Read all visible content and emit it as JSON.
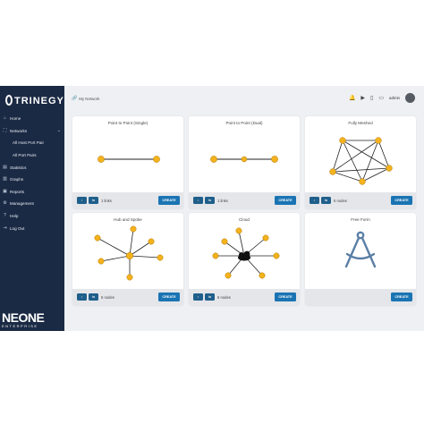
{
  "brand": {
    "name": "TRINEGY"
  },
  "sidebar": {
    "items": [
      {
        "label": "Home",
        "icon": "home-icon"
      },
      {
        "label": "Networks",
        "icon": "network-icon"
      },
      {
        "label": "All Host Port Pair",
        "icon": ""
      },
      {
        "label": "All Port Pairs",
        "icon": ""
      },
      {
        "label": "Statistics",
        "icon": "chart-icon"
      },
      {
        "label": "Graphs",
        "icon": "graph-icon"
      },
      {
        "label": "Reports",
        "icon": "report-icon"
      },
      {
        "label": "Management",
        "icon": "management-icon"
      },
      {
        "label": "Help",
        "icon": "help-icon"
      },
      {
        "label": "Log Out",
        "icon": "logout-icon"
      }
    ],
    "footer_logo": {
      "big": "NEONE",
      "small": "ENTERPRISE"
    }
  },
  "topbar": {
    "breadcrumb": "My Network",
    "user": "admin"
  },
  "cards": [
    {
      "title": "Point to Point (Single)",
      "count": "1 links",
      "create": "CREATE"
    },
    {
      "title": "Point to Point (Dual)",
      "count": "1 links",
      "create": "CREATE"
    },
    {
      "title": "Fully Meshed",
      "count": "5 nodes",
      "create": "CREATE"
    },
    {
      "title": "Hub and Spoke",
      "count": "5 nodes",
      "create": "CREATE"
    },
    {
      "title": "Cloud",
      "count": "6 nodes",
      "create": "CREATE"
    },
    {
      "title": "Free Form",
      "count": "",
      "create": "CREATE"
    }
  ],
  "colors": {
    "sidebar": "#1b2a44",
    "node": "#f4b21d",
    "create": "#1a74b3",
    "freeform": "#5b7fa6"
  }
}
